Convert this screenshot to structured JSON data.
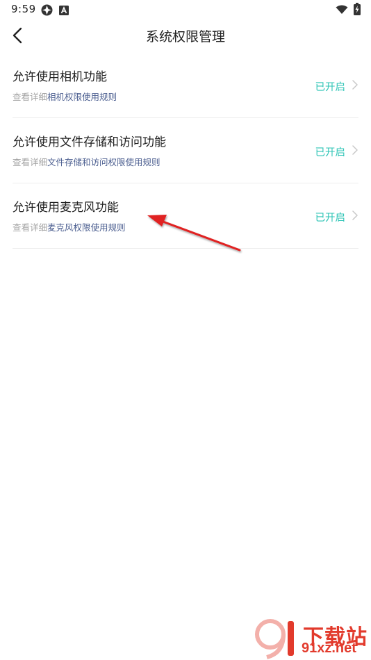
{
  "status_bar": {
    "time": "9:59"
  },
  "header": {
    "title": "系统权限管理"
  },
  "permissions": [
    {
      "title": "允许使用相机功能",
      "sub_prefix": "查看详细",
      "sub_link": "相机权限使用规则",
      "status": "已开启"
    },
    {
      "title": "允许使用文件存储和访问功能",
      "sub_prefix": "查看详细",
      "sub_link": "文件存储和访问权限使用规则",
      "status": "已开启"
    },
    {
      "title": "允许使用麦克风功能",
      "sub_prefix": "查看详细",
      "sub_link": "麦克风权限使用规则",
      "status": "已开启"
    }
  ],
  "watermark": {
    "name": "下载站",
    "domain": "91xz.net",
    "logo_text": "9"
  },
  "colors": {
    "accent": "#2ec4b6",
    "link": "#4a5d8f",
    "annotation": "#e02020",
    "watermark": "#e23a2c"
  }
}
